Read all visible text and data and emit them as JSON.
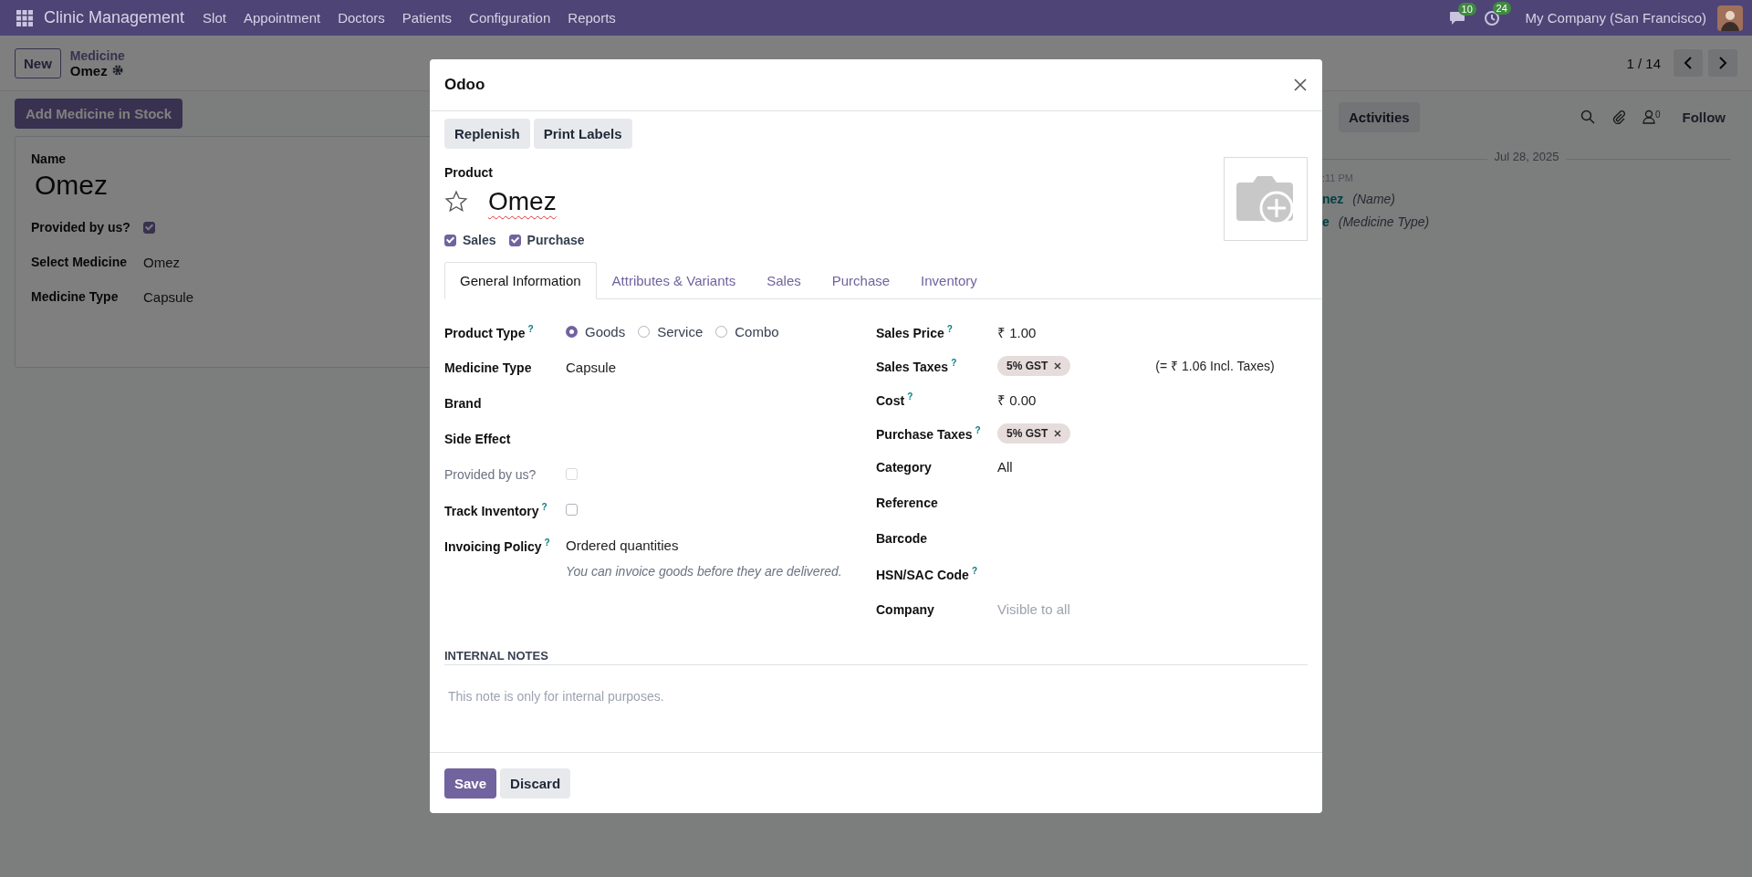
{
  "navbar": {
    "app_name": "Clinic Management",
    "menu": [
      "Slot",
      "Appointment",
      "Doctors",
      "Patients",
      "Configuration",
      "Reports"
    ],
    "messages_count": "10",
    "activities_count": "24",
    "company": "My Company (San Francisco)"
  },
  "control_panel": {
    "new_button": "New",
    "breadcrumb_parent": "Medicine",
    "breadcrumb_current": "Omez",
    "pager": "1 / 14"
  },
  "action_button": "Add Medicine in Stock",
  "sheet": {
    "name_label": "Name",
    "name": "Omez",
    "fields": [
      {
        "label": "Provided by us?",
        "kind": "checkbox",
        "checked": true
      },
      {
        "label": "Select Medicine",
        "kind": "text",
        "value": "Omez"
      },
      {
        "label": "Medicine Type",
        "kind": "text",
        "value": "Capsule"
      }
    ]
  },
  "chatter": {
    "activities_button": "Activities",
    "followers_count": "0",
    "follow": "Follow",
    "date": "Jul 28, 2025",
    "time": ":11 PM",
    "changes": [
      {
        "value": "nez",
        "field": "(Name)"
      },
      {
        "value": "e",
        "field": "(Medicine Type)"
      }
    ]
  },
  "dialog": {
    "title": "Odoo",
    "header_buttons": [
      "Replenish",
      "Print Labels"
    ],
    "product_label": "Product",
    "product_name": "Omez",
    "favorite": false,
    "options": [
      {
        "label": "Sales",
        "checked": true
      },
      {
        "label": "Purchase",
        "checked": true
      }
    ],
    "tabs": [
      {
        "label": "General Information",
        "selected": true
      },
      {
        "label": "Attributes & Variants",
        "selected": false
      },
      {
        "label": "Sales",
        "selected": false
      },
      {
        "label": "Purchase",
        "selected": false
      },
      {
        "label": "Inventory",
        "selected": false
      }
    ],
    "left_fields": [
      {
        "label": "Product Type",
        "help": "?",
        "kind": "radio",
        "options": [
          {
            "label": "Goods",
            "selected": true
          },
          {
            "label": "Service",
            "selected": false
          },
          {
            "label": "Combo",
            "selected": false
          }
        ]
      },
      {
        "label": "Medicine Type",
        "kind": "text",
        "value": "Capsule"
      },
      {
        "label": "Brand",
        "kind": "text"
      },
      {
        "label": "Side Effect",
        "kind": "text"
      },
      {
        "label": "Provided by us?",
        "kind": "checkbox",
        "checked": false,
        "disabled": true
      },
      {
        "label": "Track Inventory",
        "help": "?",
        "kind": "checkbox",
        "checked": false,
        "disabled": false
      },
      {
        "label": "Invoicing Policy",
        "help": "?",
        "kind": "text",
        "value": "Ordered quantities",
        "note": "You can invoice goods before they are delivered."
      }
    ],
    "right_fields": [
      {
        "label": "Sales Price",
        "help": "?",
        "kind": "text",
        "value": "₹ 1.00"
      },
      {
        "label": "Sales Taxes",
        "help": "?",
        "kind": "tags",
        "tags": [
          "5% GST"
        ],
        "extra": "(= ₹ 1.06 Incl. Taxes)"
      },
      {
        "label": "Cost",
        "help": "?",
        "kind": "text",
        "value": "₹ 0.00"
      },
      {
        "label": "Purchase Taxes",
        "help": "?",
        "kind": "tags",
        "tags": [
          "5% GST"
        ]
      },
      {
        "label": "Category",
        "kind": "text",
        "value": "All"
      },
      {
        "label": "Reference",
        "kind": "text"
      },
      {
        "label": "Barcode",
        "kind": "text"
      },
      {
        "label": "HSN/SAC Code",
        "help": "?",
        "kind": "text"
      },
      {
        "label": "Company",
        "kind": "text",
        "placeholder": "Visible to all"
      }
    ],
    "notes_heading": "INTERNAL NOTES",
    "notes_placeholder": "This note is only for internal purposes.",
    "footer_buttons": [
      {
        "label": "Save",
        "primary": true
      },
      {
        "label": "Discard",
        "primary": false
      }
    ]
  }
}
